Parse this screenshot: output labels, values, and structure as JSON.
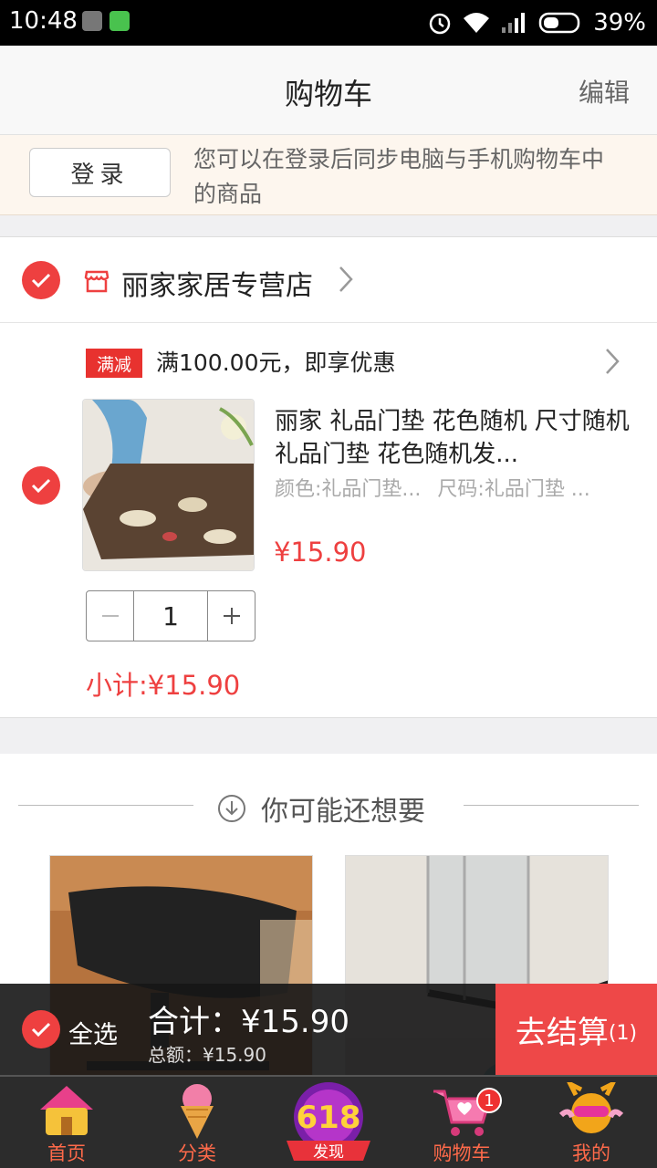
{
  "status_bar": {
    "time": "10:48",
    "battery": "39%"
  },
  "nav": {
    "title": "购物车",
    "edit_label": "编辑"
  },
  "login_banner": {
    "button_label": "登录",
    "message": "您可以在登录后同步电脑与手机购物车中的商品"
  },
  "store": {
    "name": "丽家家居专营店",
    "promo_tag": "满减",
    "promo_text": "满100.00元，即享优惠",
    "item": {
      "title": "丽家 礼品门垫 花色随机 尺寸随机 礼品门垫 花色随机发...",
      "color_spec": "颜色:礼品门垫...",
      "size_spec": "尺码:礼品门垫 ...",
      "price": "¥15.90",
      "quantity": "1"
    },
    "subtotal": "小计:¥15.90"
  },
  "recommend": {
    "title": "你可能还想要"
  },
  "checkout": {
    "select_all_label": "全选",
    "total": "合计：¥15.90",
    "sum": "总额：¥15.90",
    "button_label": "去结算",
    "button_count": "(1)"
  },
  "tabs": [
    {
      "label": "首页",
      "icon": "home-house-icon"
    },
    {
      "label": "分类",
      "icon": "icecream-icon"
    },
    {
      "label": "618",
      "sub": "发现",
      "icon": "618-discover-icon"
    },
    {
      "label": "购物车",
      "icon": "cart-icon",
      "badge": "1"
    },
    {
      "label": "我的",
      "icon": "mascot-icon"
    }
  ],
  "colors": {
    "accent": "#ee4040",
    "tabbar": "#2c2c2c",
    "banner": "#fdf6ee"
  }
}
